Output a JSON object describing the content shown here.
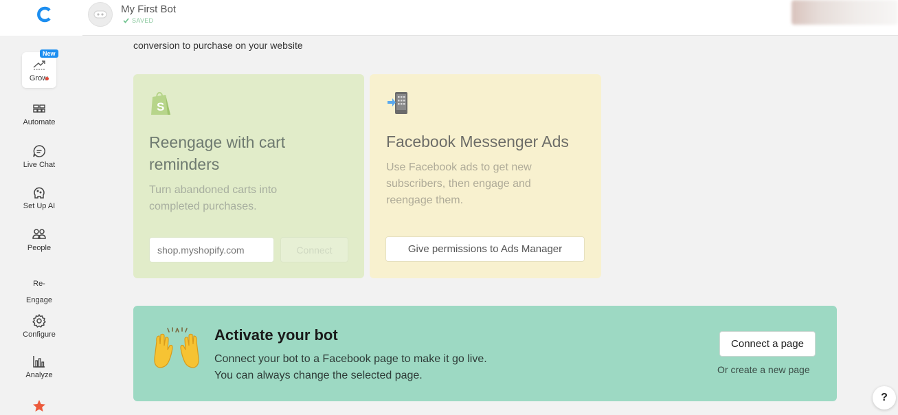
{
  "header": {
    "bot_name": "My First Bot",
    "saved_label": "SAVED"
  },
  "sidebar": {
    "new_badge": "New",
    "items": [
      {
        "label": "Grow",
        "icon": "trending-up-icon"
      },
      {
        "label": "Automate",
        "icon": "blocks-icon"
      },
      {
        "label": "Live Chat",
        "icon": "chat-bubble-icon"
      },
      {
        "label": "Set Up AI",
        "icon": "ai-brain-icon"
      },
      {
        "label": "People",
        "icon": "people-icon"
      },
      {
        "label": "Re-",
        "label2": "Engage"
      },
      {
        "label": "Configure",
        "icon": "gear-icon"
      },
      {
        "label": "Analyze",
        "icon": "bar-chart-icon"
      },
      {
        "label": "",
        "icon": "star-icon"
      }
    ]
  },
  "main": {
    "intro": "conversion to purchase on your website",
    "cards": [
      {
        "icon": "shopify-bag-icon",
        "title_line1": "Reengage with cart",
        "title_line2": "reminders",
        "desc_line1": "Turn abandoned carts into",
        "desc_line2": "completed purchases.",
        "input_placeholder": "shop.myshopify.com",
        "button": "Connect"
      },
      {
        "icon": "phone-messenger-icon",
        "title": "Facebook Messenger Ads",
        "desc_line1": "Use Facebook ads to get new",
        "desc_line2": "subscribers, then engage and",
        "desc_line3": "reengage them.",
        "button": "Give permissions to Ads Manager"
      }
    ],
    "activate": {
      "title": "Activate your bot",
      "desc_line1": "Connect your bot to a Facebook page to make it go live.",
      "desc_line2": "You can always change the selected page.",
      "button": "Connect a page",
      "link": "Or create a new page"
    }
  },
  "help": "?",
  "colors": {
    "brand_blue": "#1c8ef0",
    "shopify_card": "#e1ecc9",
    "fb_card": "#f8f1cf",
    "activate_banner": "#9dd9c3"
  }
}
